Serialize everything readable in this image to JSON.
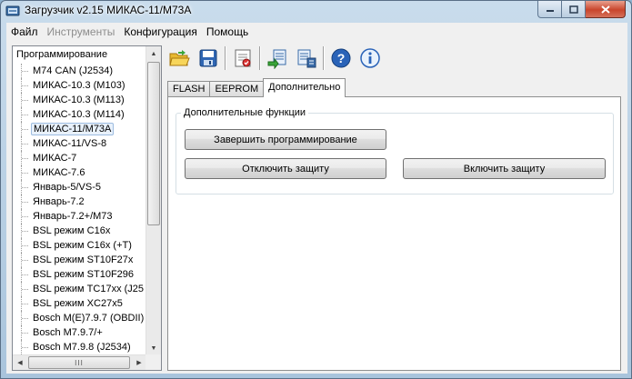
{
  "window": {
    "title": "Загрузчик v2.15 МИКАС-11/М73А"
  },
  "menu": [
    {
      "label": "Файл",
      "enabled": true
    },
    {
      "label": "Инструменты",
      "enabled": false
    },
    {
      "label": "Конфигурация",
      "enabled": true
    },
    {
      "label": "Помощь",
      "enabled": true
    }
  ],
  "tree": {
    "root_label": "Программирование",
    "items": [
      "M74 CAN (J2534)",
      "МИКАС-10.3 (М103)",
      "МИКАС-10.3 (М113)",
      "МИКАС-10.3 (М114)",
      "МИКАС-11/М73А",
      "МИКАС-11/VS-8",
      "МИКАС-7",
      "МИКАС-7.6",
      "Январь-5/VS-5",
      "Январь-7.2",
      "Январь-7.2+/М73",
      "BSL режим C16x",
      "BSL режим C16x (+T)",
      "BSL режим ST10F27x",
      "BSL режим ST10F296",
      "BSL режим TC17xx (J25",
      "BSL режим XC27x5",
      "Bosch M(E)7.9.7 (OBDII)",
      "Bosch M7.9.7/+",
      "Bosch M7.9.8 (J2534)"
    ],
    "selected_index": 4,
    "hscroll_grip": "III"
  },
  "toolbar": [
    {
      "icon": "open-folder-icon",
      "name": "open-button"
    },
    {
      "icon": "save-disk-icon",
      "name": "save-button"
    },
    {
      "icon": "settings-check-icon",
      "name": "configure-button"
    },
    {
      "icon": "read-ecu-icon",
      "name": "read-button"
    },
    {
      "icon": "write-ecu-icon",
      "name": "write-button"
    },
    {
      "icon": "help-icon",
      "name": "help-button"
    },
    {
      "icon": "info-icon",
      "name": "info-button"
    }
  ],
  "tabs": [
    {
      "label": "FLASH",
      "active": false
    },
    {
      "label": "EEPROM",
      "active": false
    },
    {
      "label": "Дополнительно",
      "active": true
    }
  ],
  "panel": {
    "group_title": "Дополнительные функции",
    "finish_label": "Завершить программирование",
    "disable_protection_label": "Отключить защиту",
    "enable_protection_label": "Включить защиту"
  },
  "colors": {
    "titlebar": "#c9dcec",
    "close_button": "#c9452c",
    "selection": "#e8f1fb"
  }
}
